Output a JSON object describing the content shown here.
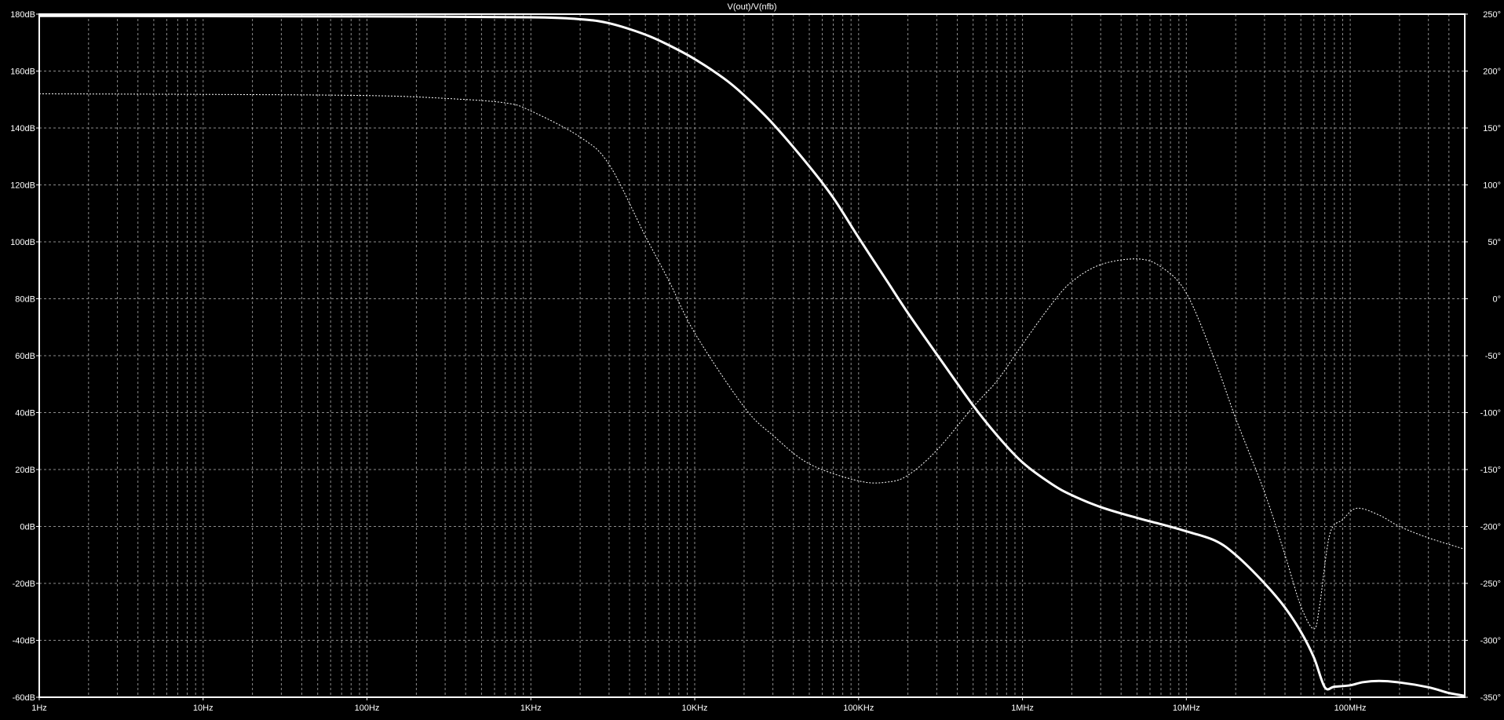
{
  "chart_data": {
    "type": "line",
    "title": "V(out)/V(nfb)",
    "x_scale": "log",
    "x_range_hz": [
      1,
      500000000
    ],
    "x_ticks": [
      {
        "value": 1,
        "label": "1Hz"
      },
      {
        "value": 10,
        "label": "10Hz"
      },
      {
        "value": 100,
        "label": "100Hz"
      },
      {
        "value": 1000,
        "label": "1KHz"
      },
      {
        "value": 10000,
        "label": "10KHz"
      },
      {
        "value": 100000,
        "label": "100KHz"
      },
      {
        "value": 1000000,
        "label": "1MHz"
      },
      {
        "value": 10000000,
        "label": "10MHz"
      },
      {
        "value": 100000000,
        "label": "100MHz"
      }
    ],
    "y_left": {
      "range": [
        -60,
        180
      ],
      "ticks": [
        {
          "value": 180,
          "label": "180dB"
        },
        {
          "value": 160,
          "label": "160dB"
        },
        {
          "value": 140,
          "label": "140dB"
        },
        {
          "value": 120,
          "label": "120dB"
        },
        {
          "value": 100,
          "label": "100dB"
        },
        {
          "value": 80,
          "label": "80dB"
        },
        {
          "value": 60,
          "label": "60dB"
        },
        {
          "value": 40,
          "label": "40dB"
        },
        {
          "value": 20,
          "label": "20dB"
        },
        {
          "value": 0,
          "label": "0dB"
        },
        {
          "value": -20,
          "label": "-20dB"
        },
        {
          "value": -40,
          "label": "-40dB"
        },
        {
          "value": -60,
          "label": "-60dB"
        }
      ]
    },
    "y_right": {
      "range": [
        -350,
        250
      ],
      "ticks": [
        {
          "value": 250,
          "label": "250°"
        },
        {
          "value": 200,
          "label": "200°"
        },
        {
          "value": 150,
          "label": "150°"
        },
        {
          "value": 100,
          "label": "100°"
        },
        {
          "value": 50,
          "label": "50°"
        },
        {
          "value": 0,
          "label": "0°"
        },
        {
          "value": -50,
          "label": "-50°"
        },
        {
          "value": -100,
          "label": "-100°"
        },
        {
          "value": -150,
          "label": "-150°"
        },
        {
          "value": -200,
          "label": "-200°"
        },
        {
          "value": -250,
          "label": "-250°"
        },
        {
          "value": -300,
          "label": "-300°"
        },
        {
          "value": -350,
          "label": "-350°"
        }
      ]
    },
    "grid": true,
    "colors": {
      "background": "#000000",
      "axis": "#ffffff",
      "grid": "#8c8c8c",
      "trace": "#ffffff"
    },
    "series": [
      {
        "axis": "left",
        "style": "solid",
        "points": [
          {
            "f": 1,
            "v": 179.4
          },
          {
            "f": 10,
            "v": 179.3
          },
          {
            "f": 100,
            "v": 179.2
          },
          {
            "f": 1000,
            "v": 178.9
          },
          {
            "f": 2000,
            "v": 178.2
          },
          {
            "f": 3000,
            "v": 176.8
          },
          {
            "f": 5000,
            "v": 172.8
          },
          {
            "f": 7000,
            "v": 169.0
          },
          {
            "f": 10000,
            "v": 164.2
          },
          {
            "f": 15000,
            "v": 157.5
          },
          {
            "f": 20000,
            "v": 151.5
          },
          {
            "f": 30000,
            "v": 141.5
          },
          {
            "f": 50000,
            "v": 126.5
          },
          {
            "f": 70000,
            "v": 115.5
          },
          {
            "f": 100000,
            "v": 101.5
          },
          {
            "f": 150000,
            "v": 86.0
          },
          {
            "f": 200000,
            "v": 75.0
          },
          {
            "f": 300000,
            "v": 60.5
          },
          {
            "f": 500000,
            "v": 42.5
          },
          {
            "f": 700000,
            "v": 32.0
          },
          {
            "f": 1000000,
            "v": 22.5
          },
          {
            "f": 1500000,
            "v": 15.0
          },
          {
            "f": 2000000,
            "v": 11.0
          },
          {
            "f": 3000000,
            "v": 6.8
          },
          {
            "f": 5000000,
            "v": 3.0
          },
          {
            "f": 7000000,
            "v": 0.8
          },
          {
            "f": 10000000,
            "v": -1.7
          },
          {
            "f": 15000000,
            "v": -5.0
          },
          {
            "f": 20000000,
            "v": -10.0
          },
          {
            "f": 30000000,
            "v": -20.0
          },
          {
            "f": 40000000,
            "v": -28.5
          },
          {
            "f": 50000000,
            "v": -37.0
          },
          {
            "f": 60000000,
            "v": -46.0
          },
          {
            "f": 70000000,
            "v": -56.5
          },
          {
            "f": 80000000,
            "v": -56.3
          },
          {
            "f": 100000000,
            "v": -55.8
          },
          {
            "f": 120000000,
            "v": -54.7
          },
          {
            "f": 150000000,
            "v": -54.3
          },
          {
            "f": 200000000,
            "v": -54.8
          },
          {
            "f": 300000000,
            "v": -56.5
          },
          {
            "f": 400000000,
            "v": -58.5
          },
          {
            "f": 500000000,
            "v": -59.5
          }
        ]
      },
      {
        "axis": "right",
        "style": "dotted",
        "points": [
          {
            "f": 1,
            "v": 180
          },
          {
            "f": 10,
            "v": 179.5
          },
          {
            "f": 100,
            "v": 178.5
          },
          {
            "f": 300,
            "v": 176
          },
          {
            "f": 700,
            "v": 172
          },
          {
            "f": 1000,
            "v": 165
          },
          {
            "f": 2000,
            "v": 142
          },
          {
            "f": 3000,
            "v": 118
          },
          {
            "f": 5000,
            "v": 55
          },
          {
            "f": 7000,
            "v": 15
          },
          {
            "f": 10000,
            "v": -30
          },
          {
            "f": 20000,
            "v": -95
          },
          {
            "f": 30000,
            "v": -120
          },
          {
            "f": 50000,
            "v": -145
          },
          {
            "f": 100000,
            "v": -160
          },
          {
            "f": 150000,
            "v": -161
          },
          {
            "f": 200000,
            "v": -155
          },
          {
            "f": 300000,
            "v": -133
          },
          {
            "f": 500000,
            "v": -95
          },
          {
            "f": 700000,
            "v": -72
          },
          {
            "f": 1000000,
            "v": -40
          },
          {
            "f": 1500000,
            "v": -5
          },
          {
            "f": 2000000,
            "v": 15
          },
          {
            "f": 3000000,
            "v": 30
          },
          {
            "f": 5000000,
            "v": 35
          },
          {
            "f": 7000000,
            "v": 28
          },
          {
            "f": 10000000,
            "v": 5
          },
          {
            "f": 15000000,
            "v": -55
          },
          {
            "f": 20000000,
            "v": -105
          },
          {
            "f": 30000000,
            "v": -170
          },
          {
            "f": 40000000,
            "v": -225
          },
          {
            "f": 50000000,
            "v": -270
          },
          {
            "f": 60000000,
            "v": -290
          },
          {
            "f": 65000000,
            "v": -270
          },
          {
            "f": 75000000,
            "v": -207
          },
          {
            "f": 90000000,
            "v": -194
          },
          {
            "f": 110000000,
            "v": -184
          },
          {
            "f": 150000000,
            "v": -190
          },
          {
            "f": 200000000,
            "v": -200
          },
          {
            "f": 300000000,
            "v": -210
          },
          {
            "f": 500000000,
            "v": -220
          }
        ]
      }
    ]
  }
}
